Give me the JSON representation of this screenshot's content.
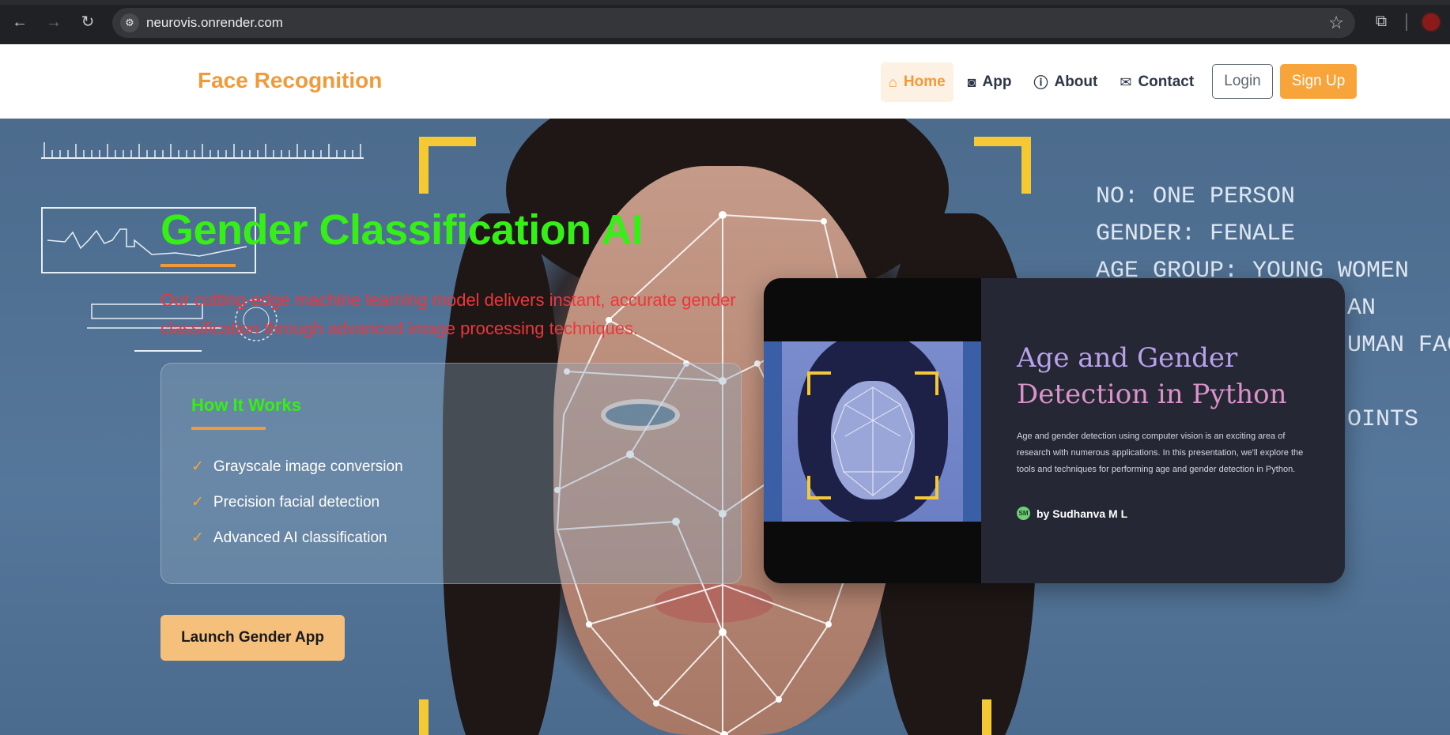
{
  "browser": {
    "url": "neurovis.onrender.com"
  },
  "header": {
    "brand": "Face Recognition",
    "nav": [
      {
        "label": "Home",
        "icon": "home-icon",
        "active": true
      },
      {
        "label": "App",
        "icon": "camera-icon",
        "active": false
      },
      {
        "label": "About",
        "icon": "info-icon",
        "active": false
      },
      {
        "label": "Contact",
        "icon": "envelope-icon",
        "active": false
      }
    ],
    "login_label": "Login",
    "signup_label": "Sign Up"
  },
  "hero": {
    "title": "Gender Classification AI",
    "subtitle": "Our cutting-edge machine learning model delivers instant, accurate gender classification through advanced image processing techniques.",
    "hud_lines": [
      "NO: ONE PERSON",
      "GENDER: FENALE",
      "AGE GROUP: YOUNG WOMEN",
      "AN",
      "UMAN FAC",
      "",
      "OINTS"
    ],
    "how_it_works": {
      "title": "How It Works",
      "items": [
        "Grayscale image conversion",
        "Precision facial detection",
        "Advanced AI classification"
      ]
    },
    "launch_label": "Launch Gender App"
  },
  "presentation": {
    "title_line1": "Age and Gender",
    "title_line2": "Detection in Python",
    "description": "Age and gender detection using computer vision is an exciting area of research with numerous applications. In this presentation, we'll explore the tools and techniques for performing age and gender detection in Python.",
    "author_initials": "SM",
    "author": "by Sudhanva M L"
  },
  "colors": {
    "brand": "#f29a3a",
    "title_green": "#35ef17",
    "subtitle_red": "#f0353a",
    "signup_bg": "#f7a43b",
    "card_dark": "#252734"
  }
}
